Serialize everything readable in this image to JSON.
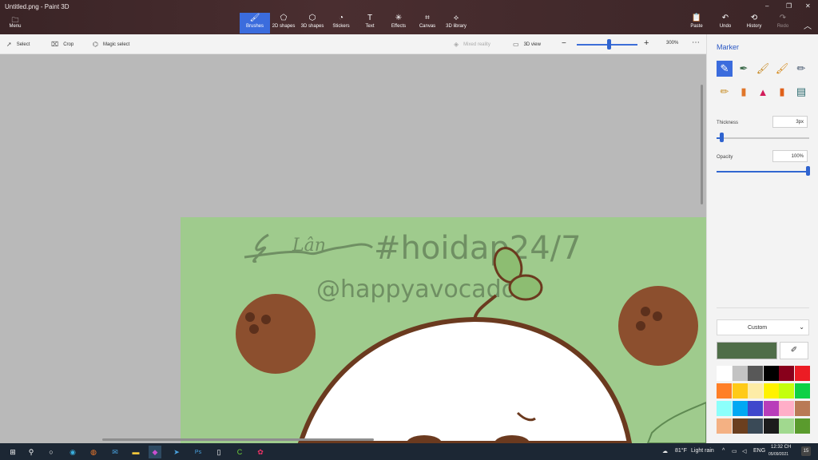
{
  "window": {
    "title": "Untitled.png - Paint 3D"
  },
  "top_menu": {
    "menu_label": "Menu"
  },
  "tools": [
    {
      "label": "Brushes",
      "icon": "brush-icon",
      "active": true
    },
    {
      "label": "2D shapes",
      "icon": "2d-shapes-icon",
      "active": false
    },
    {
      "label": "3D shapes",
      "icon": "3d-shapes-icon",
      "active": false
    },
    {
      "label": "Stickers",
      "icon": "stickers-icon",
      "active": false
    },
    {
      "label": "Text",
      "icon": "text-icon",
      "active": false
    },
    {
      "label": "Effects",
      "icon": "effects-icon",
      "active": false
    },
    {
      "label": "Canvas",
      "icon": "canvas-icon",
      "active": false
    },
    {
      "label": "3D library",
      "icon": "3d-library-icon",
      "active": false
    }
  ],
  "right_actions": {
    "paste": "Paste",
    "undo": "Undo",
    "history": "History",
    "redo": "Redo"
  },
  "secondary_toolbar": {
    "select": "Select",
    "crop": "Crop",
    "magic_select": "Magic select",
    "mixed_reality": "Mixed reality",
    "view_3d": "3D view",
    "zoom": "300%",
    "zoom_fraction": 0.5
  },
  "side_panel": {
    "title": "Marker",
    "thickness_label": "Thickness",
    "thickness_value": "3px",
    "thickness_fraction": 0.05,
    "opacity_label": "Opacity",
    "opacity_value": "100%",
    "opacity_fraction": 1.0,
    "custom_label": "Custom",
    "current_color": "#4f6d48",
    "palette": [
      "#ffffff",
      "#c3c3c3",
      "#585858",
      "#000000",
      "#88001b",
      "#ec1c24",
      "#ff7f27",
      "#ffca18",
      "#fdeca6",
      "#fff200",
      "#c4ff0e",
      "#0ed145",
      "#8cfffb",
      "#00a8f3",
      "#3f48cc",
      "#b83dba",
      "#ffaec8",
      "#b97a56",
      "#f4b183",
      "#6b3f1f",
      "#3a4a57",
      "#1c1c1c",
      "#a1d98f",
      "#5a9b2d"
    ]
  },
  "artwork": {
    "hashtag_text": "#hoidap24/7",
    "handle_text": "@happyavocado",
    "signature_text": "Lân"
  },
  "taskbar": {
    "weather_temp": "81°F",
    "weather_desc": "Light rain",
    "lang": "ENG",
    "time": "12:32 CH",
    "date": "05/09/2021",
    "notification_count": "15"
  }
}
